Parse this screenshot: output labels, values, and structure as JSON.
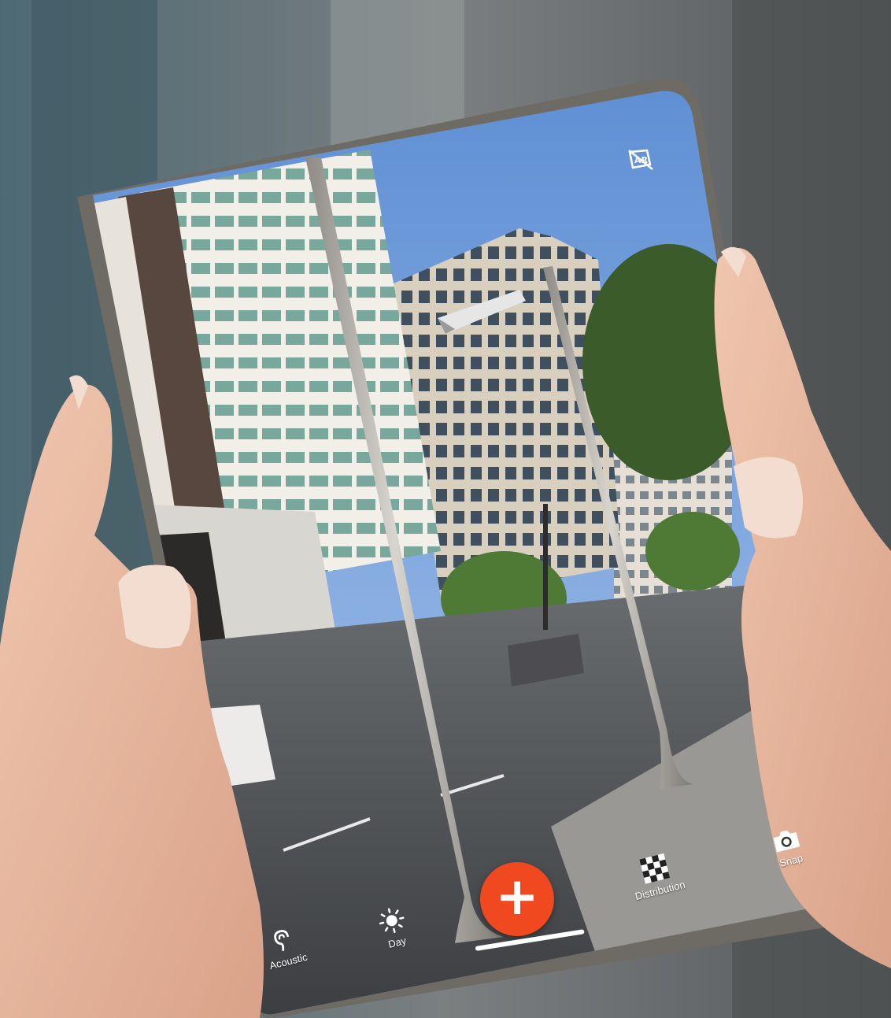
{
  "toolbar": {
    "acoustic": {
      "label": "Acoustic",
      "icon": "ear-icon"
    },
    "day": {
      "label": "Day",
      "icon": "sun-icon"
    },
    "add": {
      "label": "+",
      "icon": "plus-icon"
    },
    "distribution": {
      "label": "Distribution",
      "icon": "checkerboard-icon"
    },
    "snap": {
      "label": "Snap",
      "icon": "camera-icon"
    }
  },
  "ar_toggle": {
    "icon": "ar-off-icon"
  },
  "colors": {
    "accent": "#f0481f",
    "sky": "#6f9dd8",
    "device_frame": "#6b655d",
    "skin": "#e7b79f",
    "pole": "#b9b6b0"
  }
}
